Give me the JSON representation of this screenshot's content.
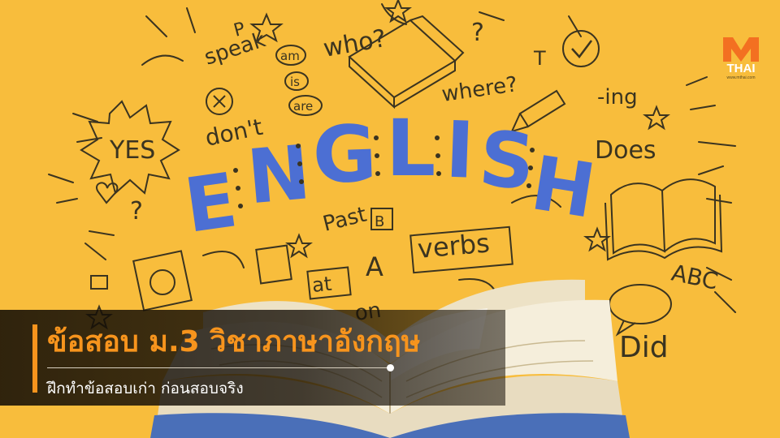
{
  "image": {
    "description_words": [
      "speak",
      "who?",
      "am",
      "is",
      "are",
      "don't",
      "where?",
      "-ing",
      "YES",
      "Does",
      "Past",
      "verbs",
      "at",
      "on",
      "ABC",
      "Did"
    ],
    "letters": [
      "E",
      "N",
      "G",
      "L",
      "I",
      "S",
      "H"
    ],
    "small_letters": [
      "P",
      "T",
      "B",
      "A"
    ],
    "colors": {
      "background": "#f8bd3c",
      "headline_blue": "#4c6fd3",
      "doodle_ink": "#3b3420",
      "caption_accent": "#f7941d"
    }
  },
  "caption": {
    "title": "ข้อสอบ ม.3 วิชาภาษาอังกฤษ",
    "subtitle": "ฝึกทำข้อสอบเก่า ก่อนสอบจริง"
  },
  "logo": {
    "wordmark": "THAI",
    "url": "www.mthai.com",
    "icon": "m-logo-icon"
  }
}
